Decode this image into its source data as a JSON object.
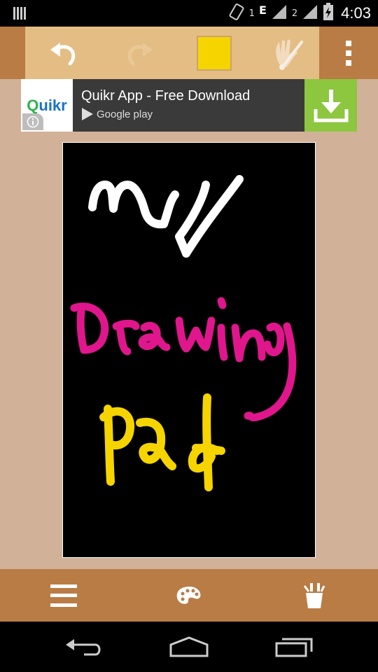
{
  "status_bar": {
    "sim1_label": "1",
    "network_type": "E",
    "sim2_label": "2",
    "time": "4:03"
  },
  "toolbar": {
    "undo_icon": "undo-icon",
    "redo_icon": "redo-icon",
    "selected_color": "#f5d400",
    "brush_icon": "hand-brush-icon",
    "overflow_icon": "overflow-menu-icon"
  },
  "ad": {
    "logo_text_q": "Q",
    "logo_text_rest": "uikr",
    "title": "Quikr App - Free Download",
    "store_label": "Google play"
  },
  "canvas": {
    "background": "#000000",
    "strokes": [
      {
        "color": "#ffffff",
        "text": "my"
      },
      {
        "color": "#e0168c",
        "text": "Drawing"
      },
      {
        "color": "#f5d400",
        "text": "pad"
      }
    ]
  },
  "bottom_bar": {
    "menu_icon": "menu-icon",
    "palette_icon": "palette-icon",
    "brushes_icon": "brushes-icon"
  },
  "nav_bar": {
    "back_icon": "back-icon",
    "home_icon": "home-icon",
    "recents_icon": "recents-icon"
  }
}
